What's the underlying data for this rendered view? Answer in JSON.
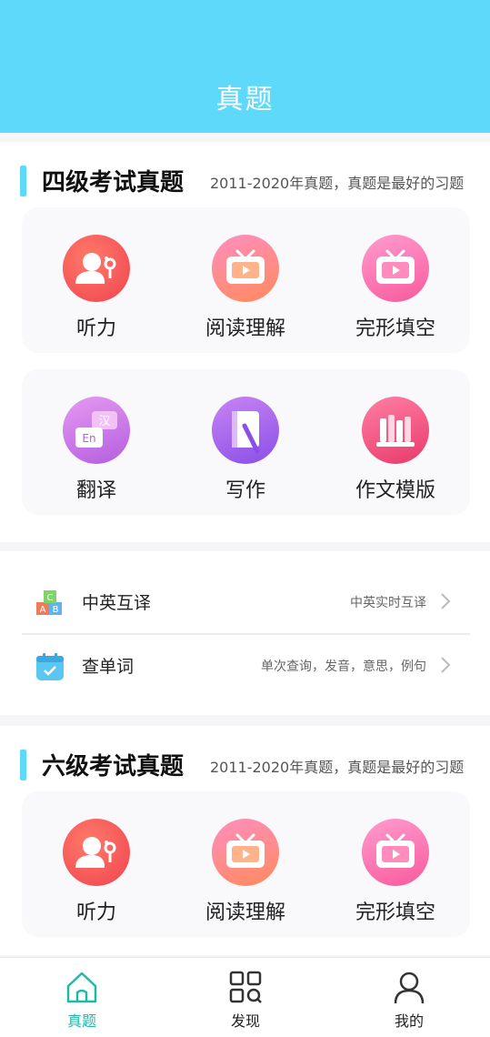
{
  "header": {
    "title": "真题"
  },
  "cet4": {
    "title": "四级考试真题",
    "subtitle": "2011-2020年真题，真题是最好的习题",
    "items": [
      {
        "label": "听力",
        "icon": "listening-icon"
      },
      {
        "label": "阅读理解",
        "icon": "tv-reading-icon"
      },
      {
        "label": "完形填空",
        "icon": "tv-cloze-icon"
      },
      {
        "label": "翻译",
        "icon": "translate-bubble-icon"
      },
      {
        "label": "写作",
        "icon": "notebook-pen-icon"
      },
      {
        "label": "作文模版",
        "icon": "bookshelf-icon"
      }
    ]
  },
  "tools": [
    {
      "title": "中英互译",
      "desc": "中英实时互译",
      "icon": "abc-blocks-icon"
    },
    {
      "title": "查单词",
      "desc": "单次查询，发音，意思，例句",
      "icon": "calendar-check-icon"
    }
  ],
  "cet6": {
    "title": "六级考试真题",
    "subtitle": "2011-2020年真题，真题是最好的习题",
    "items": [
      {
        "label": "听力",
        "icon": "listening-icon"
      },
      {
        "label": "阅读理解",
        "icon": "tv-reading-icon"
      },
      {
        "label": "完形填空",
        "icon": "tv-cloze-icon"
      }
    ]
  },
  "tabbar": {
    "tabs": [
      {
        "label": "真题",
        "icon": "home-icon",
        "active": true
      },
      {
        "label": "发现",
        "icon": "grid-search-icon",
        "active": false
      },
      {
        "label": "我的",
        "icon": "user-icon",
        "active": false
      }
    ]
  },
  "colors": {
    "accent": "#5fd9f9",
    "active_tab": "#22b8a8"
  }
}
